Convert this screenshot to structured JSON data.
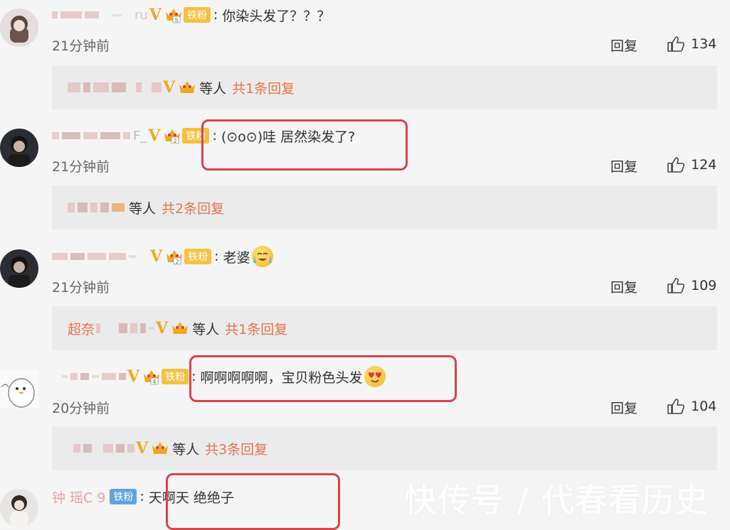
{
  "comments": [
    {
      "name_visible": "ru",
      "fan_badge": "铁粉",
      "fan_level": "5",
      "text": "你染头发了？？？",
      "time": "21分钟前",
      "reply": "回复",
      "likes": "134",
      "sub_suffix": "等人",
      "sub_count": "共1条回复"
    },
    {
      "name_visible": "F_",
      "fan_badge": "铁粉",
      "fan_level": "2",
      "text": "(⊙o⊙)哇 居然染发了?",
      "time": "21分钟前",
      "reply": "回复",
      "likes": "124",
      "sub_suffix": "等人",
      "sub_count": "共2条回复"
    },
    {
      "name_visible": "",
      "fan_badge": "铁粉",
      "fan_level": "2",
      "text": "老婆",
      "time": "21分钟前",
      "reply": "回复",
      "likes": "109",
      "sub_prefix": "超奈",
      "sub_suffix": "等人",
      "sub_count": "共1条回复"
    },
    {
      "name_visible": "",
      "fan_badge": "铁粉",
      "fan_level": "4",
      "text": "啊啊啊啊啊，宝贝粉色头发",
      "time": "20分钟前",
      "reply": "回复",
      "likes": "104",
      "sub_suffix": "等人",
      "sub_count": "共3条回复"
    },
    {
      "name_visible": "钟  瑶C  9",
      "fan_badge": "铁粉",
      "text": "天啊天 绝绝子"
    }
  ],
  "watermark": "快传号 / 代春看历史",
  "colors": {
    "highlight": "#d9434d",
    "reply_count": "#e8734a",
    "vip": "#f0a91e",
    "fan_badge": "#f5c143"
  }
}
